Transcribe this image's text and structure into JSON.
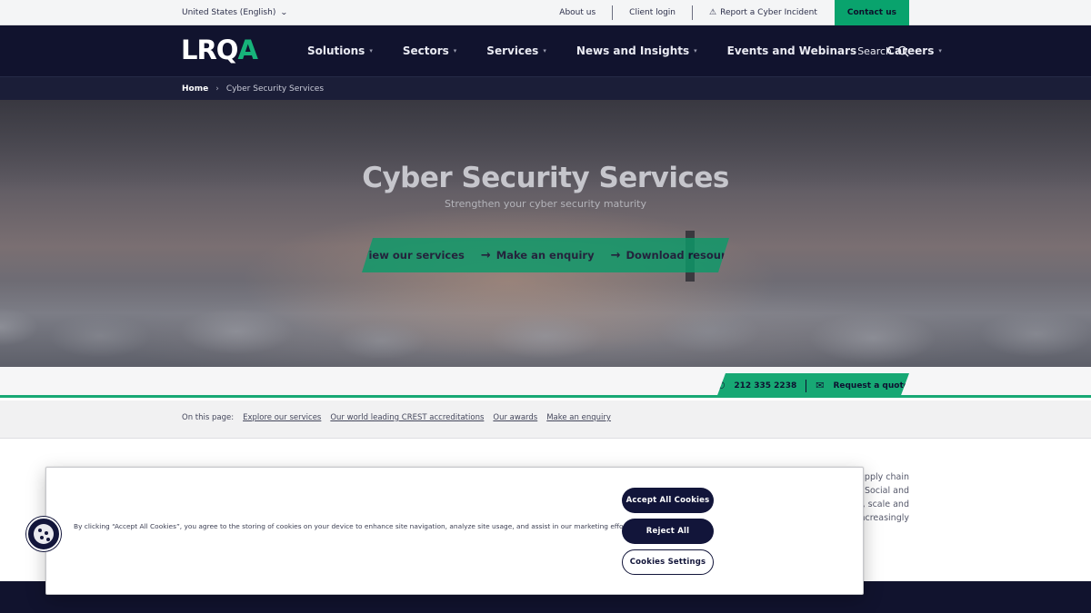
{
  "topbar": {
    "language": "United States (English)",
    "links": [
      "About us",
      "Client login",
      "Report a Cyber Incident"
    ],
    "contact": "Contact us"
  },
  "nav": {
    "logo": {
      "prefix": "LRQ",
      "accent": "A"
    },
    "items": [
      "Solutions",
      "Sectors",
      "Services",
      "News and Insights",
      "Events and Webinars",
      "Careers"
    ],
    "search": "Search"
  },
  "breadcrumb": {
    "home": "Home",
    "current": "Cyber Security Services"
  },
  "hero": {
    "title": "Cyber Security Services",
    "subtitle": "Strengthen your cyber security maturity",
    "cta": [
      "View our services",
      "Make an enquiry",
      "Download resources"
    ]
  },
  "contact_strip": {
    "phone": "212 335 2238",
    "quote": "Request a quote"
  },
  "on_this_page": {
    "label": "On this page:",
    "links": [
      "Explore our services",
      "Our world leading CREST accreditations",
      "Our awards",
      "Make an enquiry"
    ]
  },
  "body_peek": [
    "upply chain",
    "Social and",
    "d, scale and",
    "increasingly"
  ],
  "cookie": {
    "text": "By clicking “Accept All Cookies”, you agree to the storing of cookies on your device to enhance site navigation, analyze site usage, and assist in our marketing efforts.",
    "accept": "Accept All Cookies",
    "reject": "Reject All",
    "settings": "Cookies Settings"
  },
  "colors": {
    "brand_green": "#17a874",
    "navy": "#11132e"
  }
}
